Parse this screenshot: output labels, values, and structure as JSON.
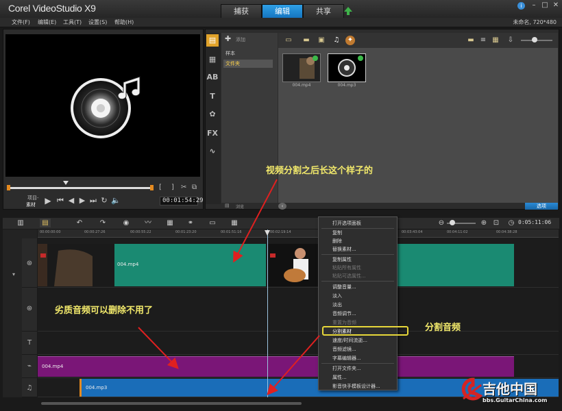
{
  "app": {
    "title": "Corel VideoStudio X9",
    "project_info": "未命名, 720*480"
  },
  "mode_tabs": [
    {
      "label": "捕获",
      "active": false
    },
    {
      "label": "编辑",
      "active": true
    },
    {
      "label": "共享",
      "active": false
    }
  ],
  "menu": [
    "文件(F)",
    "编辑(E)",
    "工具(T)",
    "设置(S)",
    "帮助(H)"
  ],
  "player": {
    "mode_project": "项目-",
    "mode_clip": "素材",
    "timecode": "00:01:54:29"
  },
  "library": {
    "add_label": "添加",
    "folders": [
      "样本",
      "文件夹"
    ],
    "selected_folder": "文件夹",
    "media": [
      {
        "name": "004.mp4",
        "type": "video"
      },
      {
        "name": "004.mp3",
        "type": "audio"
      }
    ],
    "browse_label": "浏览",
    "options_label": "选项"
  },
  "timeline": {
    "timecode": "0:05:11:06",
    "ruler": [
      "00:00:00:00",
      "00:00:27:26",
      "00:00:55:22",
      "00:01:23:20",
      "00:01:51:16",
      "00:02:19:14",
      "00:03:43:04",
      "00:04:11:02",
      "00:04:38:28"
    ],
    "clips": {
      "video": "004.mp4",
      "music_video": "004.mp4",
      "music_audio": "004.mp3"
    }
  },
  "context_menu": {
    "items": [
      {
        "label": "打开选项面板",
        "enabled": true
      },
      {
        "label": "复制",
        "enabled": true
      },
      {
        "label": "删除",
        "enabled": true
      },
      {
        "label": "替换素材...",
        "enabled": true
      },
      {
        "label": "复制属性",
        "enabled": true
      },
      {
        "label": "粘贴所有属性",
        "enabled": false
      },
      {
        "label": "粘贴可选属性...",
        "enabled": false
      },
      {
        "label": "调整音量...",
        "enabled": true
      },
      {
        "label": "淡入",
        "enabled": true
      },
      {
        "label": "淡出",
        "enabled": true
      },
      {
        "label": "音频调节...",
        "enabled": true
      },
      {
        "label": "重置为音频",
        "enabled": false
      },
      {
        "label": "分割素材",
        "enabled": true,
        "highlighted": true
      },
      {
        "label": "速度/时间流逝...",
        "enabled": true
      },
      {
        "label": "音频滤镜...",
        "enabled": true
      },
      {
        "label": "字幕编辑器...",
        "enabled": true
      },
      {
        "label": "打开文件夹...",
        "enabled": true
      },
      {
        "label": "属性...",
        "enabled": true
      },
      {
        "label": "影音快手模板设计器...",
        "enabled": true
      }
    ]
  },
  "annotations": {
    "after_split": "视频分割之后长这个样子的",
    "bad_audio": "劣质音频可以删除不用了",
    "split_audio": "分割音频"
  },
  "watermark": {
    "name": "吉他中国",
    "url": "bbs.GuitarChina.com"
  },
  "colors": {
    "accent": "#1f8ad6",
    "video_clip": "#1a8a72",
    "music_video_clip": "#7a1677",
    "audio_clip": "#1a6db8",
    "annotation": "#f2e96b",
    "arrow": "#e02020"
  }
}
